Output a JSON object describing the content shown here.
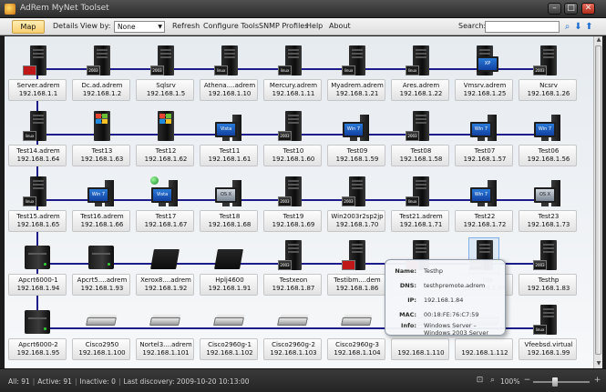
{
  "window": {
    "title": "AdRem MyNet Toolset",
    "controls": {
      "minimize": "–",
      "maximize": "□",
      "close": "✕"
    }
  },
  "toolbar": {
    "map_label": "Map",
    "details_label": "Details",
    "view_by_label": "View by:",
    "view_by_value": "None",
    "refresh_label": "Refresh",
    "configure_tools_label": "Configure Tools",
    "snmp_profiles_label": "SNMP Profiles",
    "help_label": "Help",
    "about_label": "About",
    "search_label": "Search:",
    "search_value": ""
  },
  "devices": [
    {
      "name": "Server.adrem",
      "ip": "192.168.1.1",
      "icon": "redhat-server"
    },
    {
      "name": "Dc.ad.adrem",
      "ip": "192.168.1.2",
      "icon": "server-win2003"
    },
    {
      "name": "Sqlsrv",
      "ip": "192.168.1.5",
      "icon": "server-win2003"
    },
    {
      "name": "Athena....adrem",
      "ip": "192.168.1.10",
      "icon": "server-linux"
    },
    {
      "name": "Mercury.adrem",
      "ip": "192.168.1.11",
      "icon": "server-linux"
    },
    {
      "name": "Myadrem.adrem",
      "ip": "192.168.1.21",
      "icon": "server-linux"
    },
    {
      "name": "Ares.adrem",
      "ip": "192.168.1.22",
      "icon": "server-linux"
    },
    {
      "name": "Vmsrv.adrem",
      "ip": "192.168.1.25",
      "icon": "server-xp"
    },
    {
      "name": "Ncsrv",
      "ip": "192.168.1.26",
      "icon": "server-win2003"
    },
    {
      "name": "Test14.adrem",
      "ip": "192.168.1.64",
      "icon": "server-linux"
    },
    {
      "name": "Test13",
      "ip": "192.168.1.63",
      "icon": "server-windows"
    },
    {
      "name": "Test12",
      "ip": "192.168.1.62",
      "icon": "server-windows"
    },
    {
      "name": "Test11",
      "ip": "192.168.1.61",
      "icon": "workstation-vista"
    },
    {
      "name": "Test10",
      "ip": "192.168.1.60",
      "icon": "server-win2003"
    },
    {
      "name": "Test09",
      "ip": "192.168.1.59",
      "icon": "workstation-win7"
    },
    {
      "name": "Test08",
      "ip": "192.168.1.58",
      "icon": "server-win2003"
    },
    {
      "name": "Test07",
      "ip": "192.168.1.57",
      "icon": "workstation-win7"
    },
    {
      "name": "Test06",
      "ip": "192.168.1.56",
      "icon": "workstation-win7"
    },
    {
      "name": "Test15.adrem",
      "ip": "192.168.1.65",
      "icon": "server-linux"
    },
    {
      "name": "Test16.adrem",
      "ip": "192.168.1.66",
      "icon": "workstation-win7"
    },
    {
      "name": "Test17",
      "ip": "192.168.1.67",
      "icon": "workstation-vista-globe"
    },
    {
      "name": "Test18",
      "ip": "192.168.1.68",
      "icon": "workstation-mac"
    },
    {
      "name": "Test19",
      "ip": "192.168.1.69",
      "icon": "server-win2003"
    },
    {
      "name": "Win2003r2sp2jp",
      "ip": "192.168.1.70",
      "icon": "server-win2003"
    },
    {
      "name": "Test21.adrem",
      "ip": "192.168.1.71",
      "icon": "server-linux"
    },
    {
      "name": "Test22",
      "ip": "192.168.1.72",
      "icon": "workstation-win7"
    },
    {
      "name": "Test23",
      "ip": "192.168.1.73",
      "icon": "workstation-mac"
    },
    {
      "name": "Apcrt6000-1",
      "ip": "192.168.1.94",
      "icon": "router-cube"
    },
    {
      "name": "Apcrt5....adrem",
      "ip": "192.168.1.93",
      "icon": "router-cube"
    },
    {
      "name": "Xerox8....adrem",
      "ip": "192.168.1.92",
      "icon": "printer-rack"
    },
    {
      "name": "Hplj4600",
      "ip": "192.168.1.91",
      "icon": "printer-rack"
    },
    {
      "name": "Testxeon",
      "ip": "192.168.1.87",
      "icon": "server-win2003"
    },
    {
      "name": "Testibm....dem",
      "ip": "192.168.1.86",
      "icon": "redhat-server"
    },
    {
      "name": "",
      "ip": "",
      "icon": "redhat-server"
    },
    {
      "name": "...thp",
      "ip": "192.168.1.84",
      "icon": "server-win2003"
    },
    {
      "name": "Testhp",
      "ip": "192.168.1.83",
      "icon": "server-win2003"
    },
    {
      "name": "Apcrt6000-2",
      "ip": "192.168.1.95",
      "icon": "router-cube"
    },
    {
      "name": "Cisco2950",
      "ip": "192.168.1.100",
      "icon": "switch"
    },
    {
      "name": "Nortel3....adrem",
      "ip": "192.168.1.101",
      "icon": "switch"
    },
    {
      "name": "Cisco2960g-1",
      "ip": "192.168.1.102",
      "icon": "switch"
    },
    {
      "name": "Cisco2960g-2",
      "ip": "192.168.1.103",
      "icon": "switch"
    },
    {
      "name": "Cisco2960g-3",
      "ip": "192.168.1.104",
      "icon": "switch"
    },
    {
      "name": "",
      "ip": "192.168.1.110",
      "icon": "switch"
    },
    {
      "name": "",
      "ip": "192.168.1.112",
      "icon": "switch"
    },
    {
      "name": "Vfeebsd.virtual",
      "ip": "192.168.1.99",
      "icon": "server-linux"
    }
  ],
  "tooltip": {
    "name_key": "Name:",
    "name_val": "Testhp",
    "dns_key": "DNS:",
    "dns_val": "testhpremote.adrem",
    "ip_key": "IP:",
    "ip_val": "192.168.1.84",
    "mac_key": "MAC:",
    "mac_val": "00:18:FE:76:C7:59",
    "info_key": "Info:",
    "info_val1": "Windows Server –",
    "info_val2": "Windows 2003 Server"
  },
  "status": {
    "all": "All: 91",
    "active": "Active: 91",
    "inactive": "Inactive: 0",
    "last_discovery": "Last discovery: 2009-10-20 10:13:00",
    "zoom": "100%"
  },
  "colors": {
    "link_line": "#1c1c8a",
    "accent_button": "#f8cf70",
    "windows_blue": "#1f63c6"
  }
}
